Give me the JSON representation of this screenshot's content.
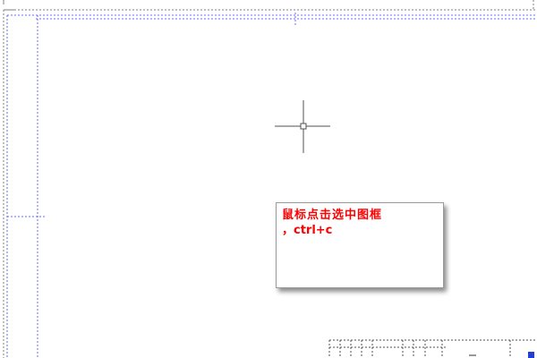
{
  "tooltip": {
    "line1": "鼠标点击选中图框",
    "line2": "，ctrl+c"
  },
  "colors": {
    "background": "#ffffff",
    "frame_line": "#7f7f7f",
    "inner_frame_line": "#6a6aff",
    "crosshair": "#505050",
    "tooltip_text": "#ff0000",
    "grip": "#1f3fd8"
  },
  "icons": {
    "cursor": "crosshair-cursor-icon",
    "grip": "grip-handle-icon"
  }
}
